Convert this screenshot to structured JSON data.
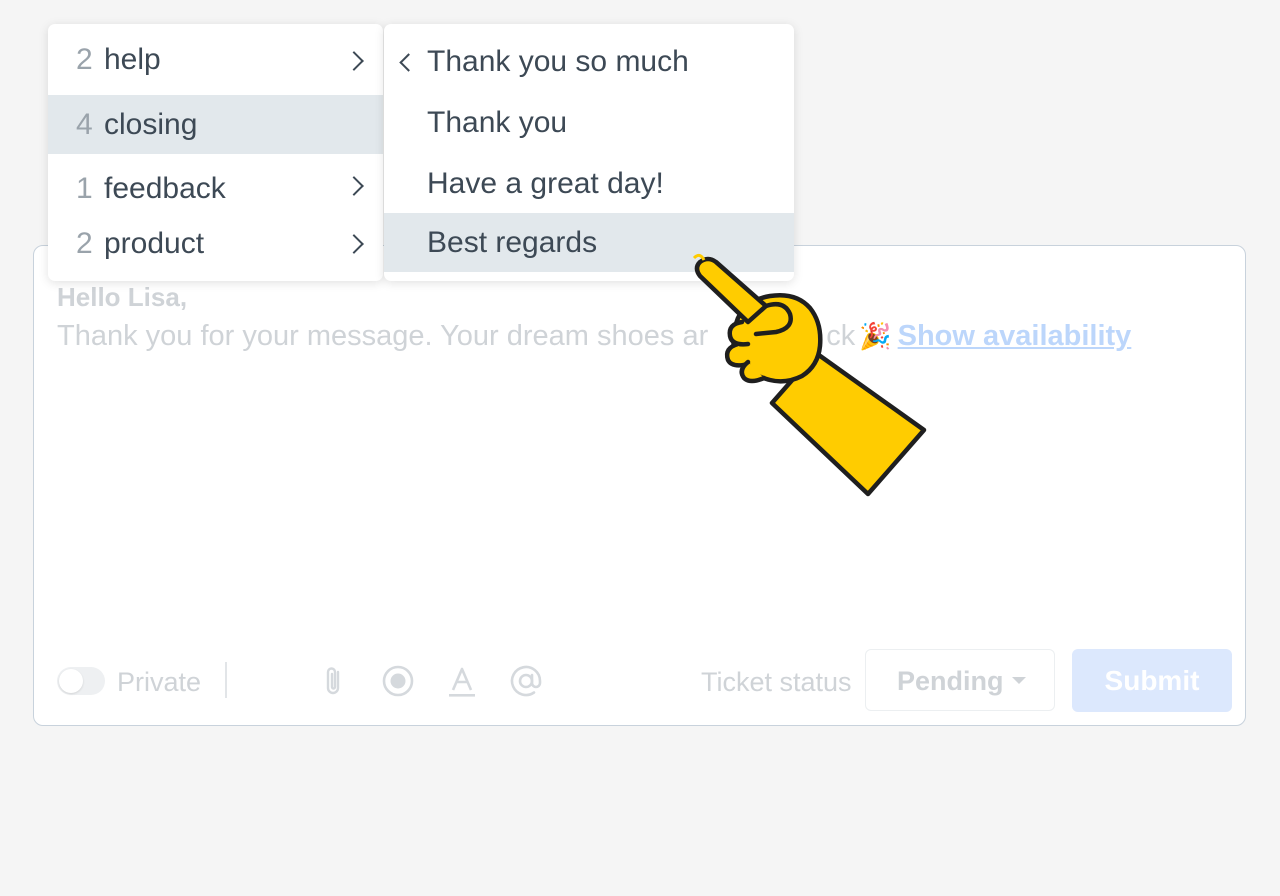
{
  "composer": {
    "greeting": "Hello Lisa,",
    "body_text": "Thank you for your message.  Your dream shoes ar",
    "body_text_tail": "ck",
    "party_emoji": "🎉",
    "link_text": "Show availability",
    "private_label": "Private",
    "ticket_status_label": "Ticket status",
    "status_value": "Pending",
    "submit_label": "Submit"
  },
  "tag_menu": {
    "items": [
      {
        "count": "2",
        "label": "help"
      },
      {
        "count": "4",
        "label": "closing"
      },
      {
        "count": "1",
        "label": "feedback"
      },
      {
        "count": "2",
        "label": "product"
      }
    ]
  },
  "submenu": {
    "items": [
      {
        "label": "Thank you so much"
      },
      {
        "label": "Thank you"
      },
      {
        "label": "Have a great day!"
      },
      {
        "label": "Best regards"
      }
    ]
  },
  "icons": {
    "attach": "paperclip-icon",
    "record": "record-icon",
    "format": "text-format-icon",
    "mention": "at-sign-icon",
    "pointer": "pointing-hand-icon"
  },
  "colors": {
    "accent_hand": "#ffcc00",
    "menu_highlight": "#e2e8ec",
    "submit_bg": "#dce8fd",
    "link": "#bcd6fb"
  }
}
